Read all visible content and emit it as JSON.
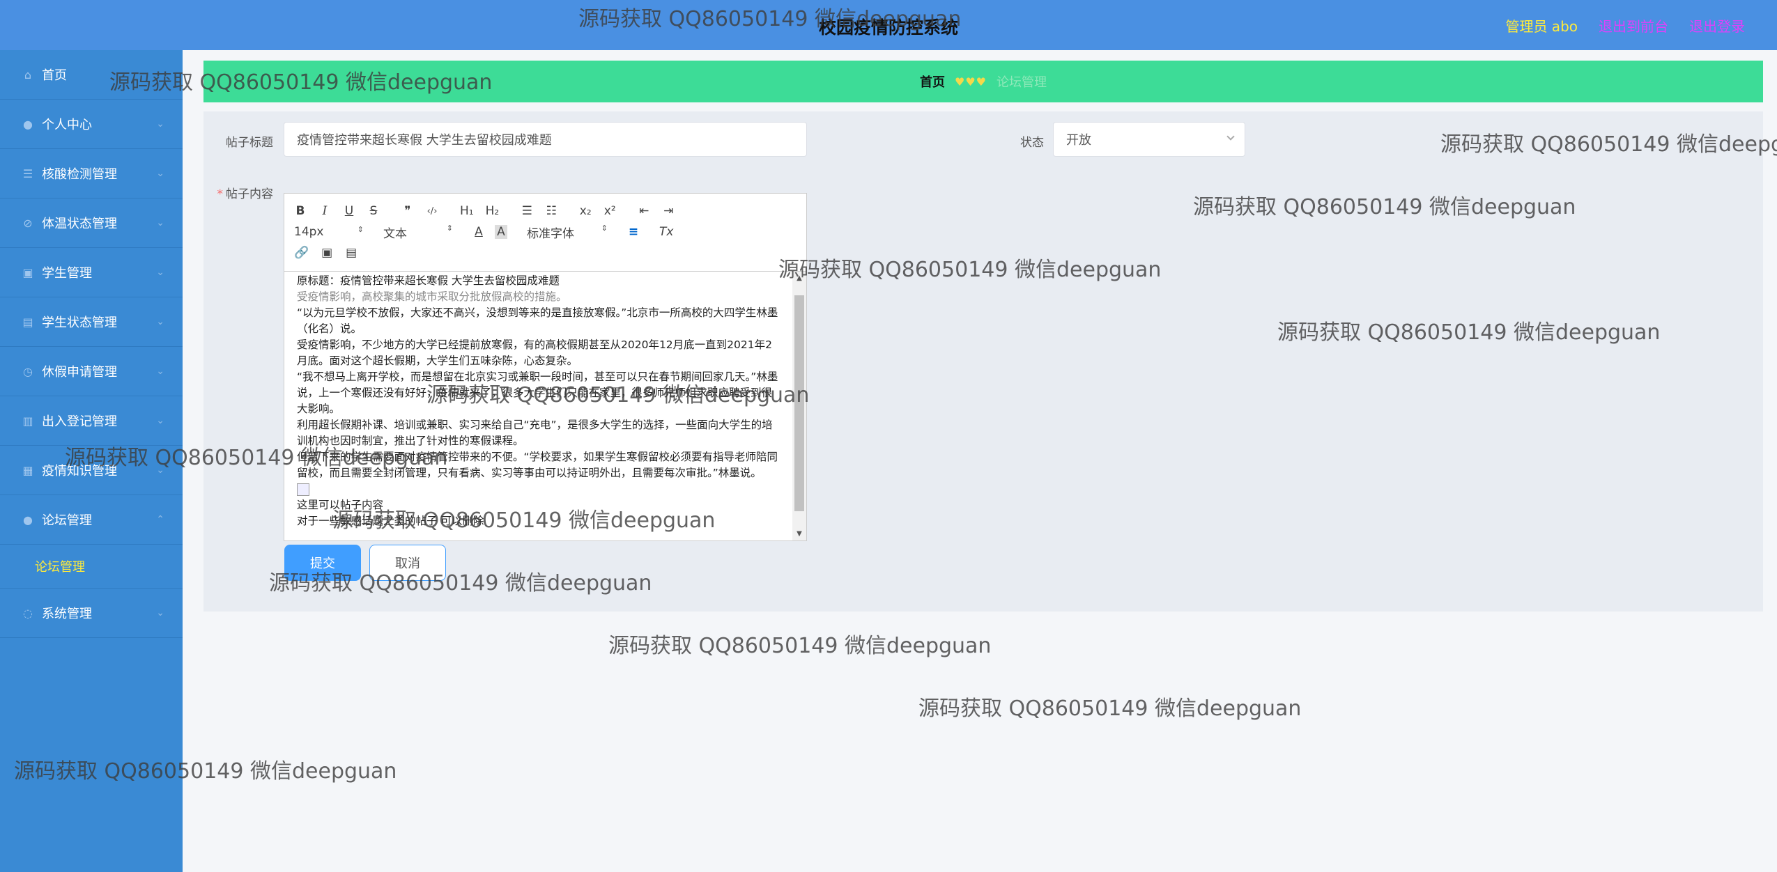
{
  "header": {
    "title": "校园疫情防控系统",
    "user_label": "管理员 abo",
    "back_link": "退出到前台",
    "logout_link": "退出登录"
  },
  "sidebar": {
    "items": [
      {
        "label": "首页",
        "icon": "home-icon"
      },
      {
        "label": "个人中心",
        "icon": "user-icon"
      },
      {
        "label": "核酸检测管理",
        "icon": "sliders-icon"
      },
      {
        "label": "体温状态管理",
        "icon": "thermometer-icon"
      },
      {
        "label": "学生管理",
        "icon": "image-icon"
      },
      {
        "label": "学生状态管理",
        "icon": "clipboard-icon"
      },
      {
        "label": "休假申请管理",
        "icon": "clock-icon"
      },
      {
        "label": "出入登记管理",
        "icon": "chart-icon"
      },
      {
        "label": "疫情知识管理",
        "icon": "book-icon"
      },
      {
        "label": "论坛管理",
        "icon": "user-icon"
      },
      {
        "label": "系统管理",
        "icon": "globe-icon"
      }
    ],
    "sub_item": "论坛管理"
  },
  "breadcrumb": {
    "home": "首页",
    "separator": "♥♥♥",
    "current": "论坛管理"
  },
  "form": {
    "title_label": "帖子标题",
    "title_value": "疫情管控带来超长寒假 大学生去留校园成难题",
    "status_label": "状态",
    "status_value": "开放",
    "content_label": "帖子内容",
    "required_mark": "*"
  },
  "editor": {
    "toolbar": {
      "bold": "B",
      "italic": "I",
      "underline": "U",
      "strike": "S",
      "quote": "❞",
      "code": "‹/›",
      "h1": "H₁",
      "h2": "H₂",
      "ordered_list": "☰",
      "bullet_list": "☷",
      "subscript": "x₂",
      "superscript": "x²",
      "outdent": "⇤",
      "indent": "⇥",
      "size": "14px",
      "block": "文本",
      "color": "A",
      "bg": "A",
      "font": "标准字体",
      "align": "≡",
      "clean": "Tx",
      "link": "🔗",
      "image": "▣",
      "video": "▤"
    },
    "lines": [
      "原标题：疫情管控带来超长寒假 大学生去留校园成难题",
      "受疫情影响，高校聚集的城市采取分批放假高校的措施。",
      "“以为元旦学校不放假，大家还不高兴，没想到等来的是直接放寒假。”北京市一所高校的大四学生林墨（化名）说。",
      "受疫情影响，不少地方的大学已经提前放寒假，有的高校假期甚至从2020年12月底一直到2021年2月底。面对这个超长假期，大学生们五味杂陈，心态复杂。",
      "“我不想马上离开学校，而是想留在北京实习或兼职一段时间，甚至可以只在春节期间回家几天。”林墨说，上一个寒假还没有好好，疫情就来了，很多大学生们只能在家里，很多师兄师姐求职应聘受到很大影响。",
      "利用超长假期补课、培训或兼职、实习来给自己“充电”，是很多大学生的选择，一些面向大学生的培训机构也因时制宜，推出了针对性的寒假课程。",
      "但留下来的学生需要面对疫情管控带来的不便。“学校要求，如果学生寒假留校必须要有指导老师陪同留校，而且需要全封闭管理，只有看病、实习等事由可以持证明外出，且需要每次审批。”林墨说。",
      "这里可以帖子内容",
      "对于一些敏感话题之类的帖子 可以删除"
    ]
  },
  "buttons": {
    "submit": "提交",
    "cancel": "取消"
  },
  "watermark": "源码获取 QQ86050149 微信deepguan",
  "colors": {
    "header": "#4a90e2",
    "sidebar": "#3a8ad4",
    "breadcrumb_bar": "#3ddc97",
    "primary": "#409eff",
    "user_text": "#ffeb3b",
    "link_text": "#e040fb"
  }
}
